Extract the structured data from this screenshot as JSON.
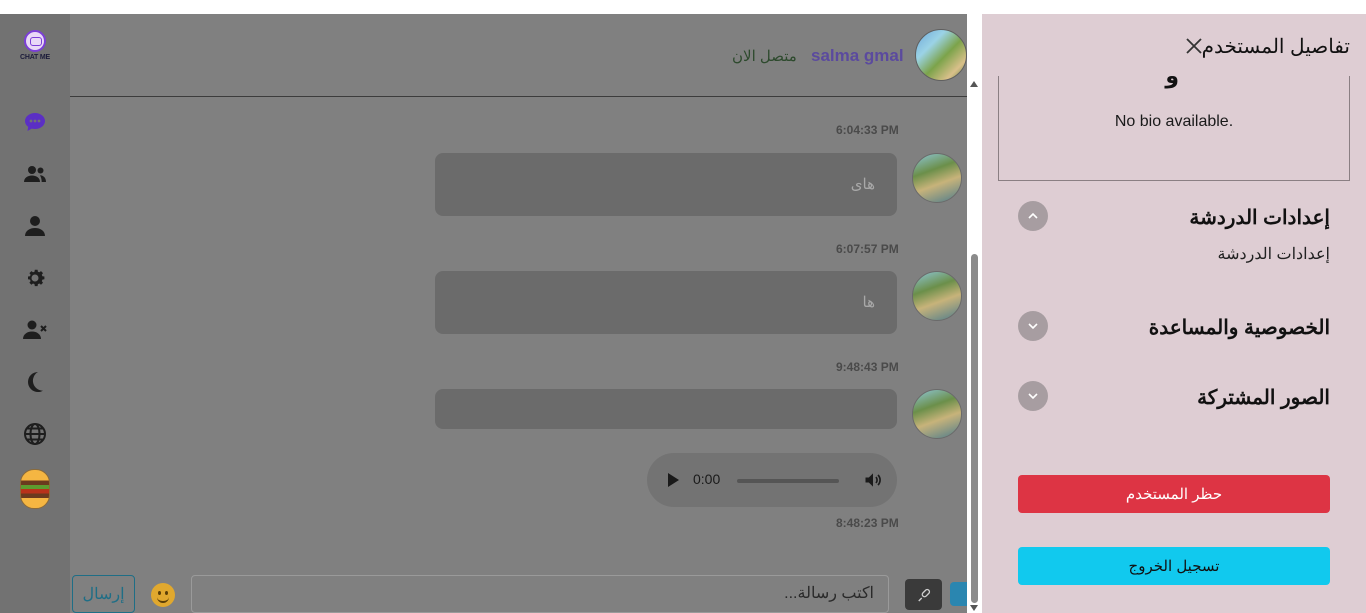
{
  "sidebar": {
    "logo_text": "CHAT ME",
    "items": [
      {
        "icon": "chat-bubble-icon",
        "color": "#5b2fc4"
      },
      {
        "icon": "users-icon"
      },
      {
        "icon": "user-icon"
      },
      {
        "icon": "gear-icon"
      },
      {
        "icon": "user-block-icon"
      },
      {
        "icon": "moon-icon"
      },
      {
        "icon": "globe-icon"
      }
    ]
  },
  "chat": {
    "header": {
      "name": "salma gmal",
      "status": "متصل الان"
    },
    "messages": [
      {
        "time": "6:04:33 PM",
        "text": "هاى"
      },
      {
        "time": "6:07:57 PM",
        "text": "ها"
      },
      {
        "time": "9:48:43 PM",
        "text": ""
      }
    ],
    "audio": {
      "time": "0:00",
      "sent_time": "8:48:23 PM"
    },
    "composer": {
      "send_label": "إرسال",
      "placeholder": "اكتب رسالة..."
    }
  },
  "panel": {
    "title": "تفاصيل المستخدم",
    "bio_glyph": "و",
    "bio": "No bio available.",
    "sections": [
      {
        "title": "إعدادات الدردشة",
        "expanded": true,
        "content": "إعدادات الدردشة"
      },
      {
        "title": "الخصوصية والمساعدة",
        "expanded": false
      },
      {
        "title": "الصور المشتركة",
        "expanded": false
      }
    ],
    "block_label": "حظر المستخدم",
    "logout_label": "تسجيل الخروج"
  },
  "colors": {
    "overlay": "#808080",
    "panel_bg": "#decdd3",
    "danger": "#dd3444",
    "info": "#11c9ee",
    "accent": "#5b4a9e"
  }
}
